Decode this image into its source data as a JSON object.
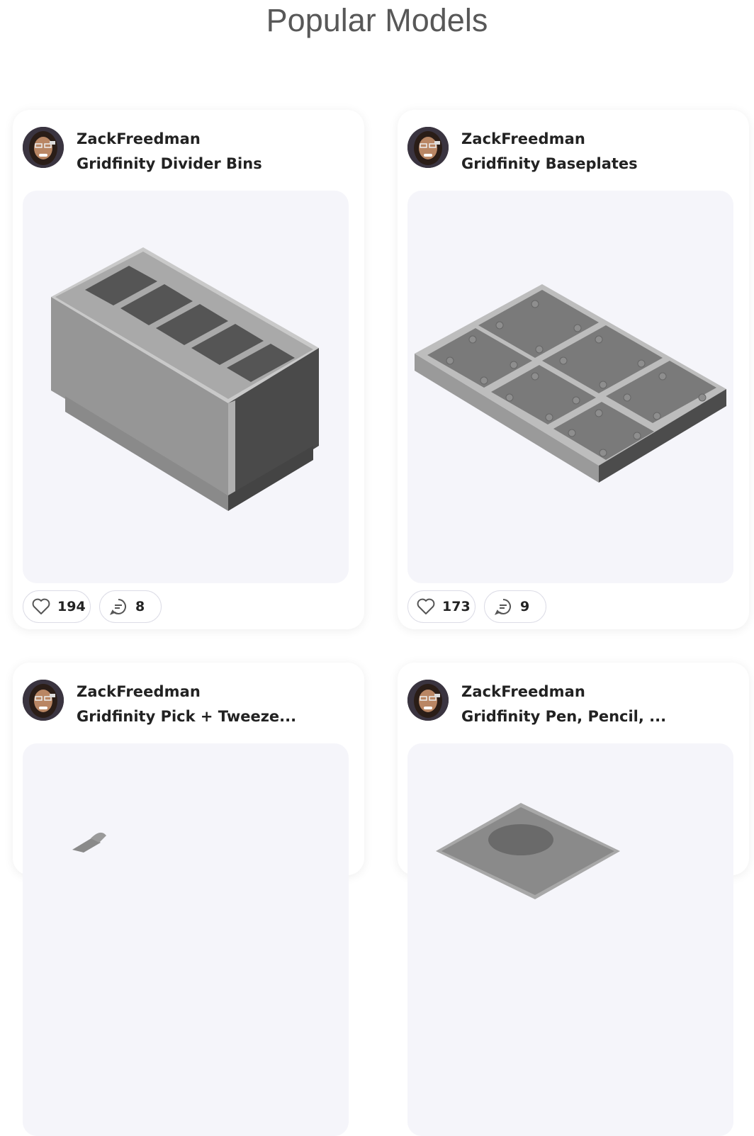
{
  "page": {
    "title": "Popular Models"
  },
  "cards": [
    {
      "author": "ZackFreedman",
      "name": "Gridfinity Divider Bins",
      "likes": "194",
      "comments": "8",
      "preview": "divider-bin-model"
    },
    {
      "author": "ZackFreedman",
      "name": "Gridfinity Baseplates",
      "likes": "173",
      "comments": "9",
      "preview": "baseplate-model"
    },
    {
      "author": "ZackFreedman",
      "name": "Gridfinity Pick + Tweeze...",
      "preview": "pick-tweezer-model"
    },
    {
      "author": "ZackFreedman",
      "name": "Gridfinity Pen, Pencil, ...",
      "preview": "pen-pencil-model"
    }
  ],
  "colors": {
    "preview_bg": "#f5f5fa",
    "model_grey": "#9a9a9a",
    "title": "#585858"
  },
  "icons": {
    "like": "heart-icon",
    "comment": "comment-bubble-icon"
  }
}
